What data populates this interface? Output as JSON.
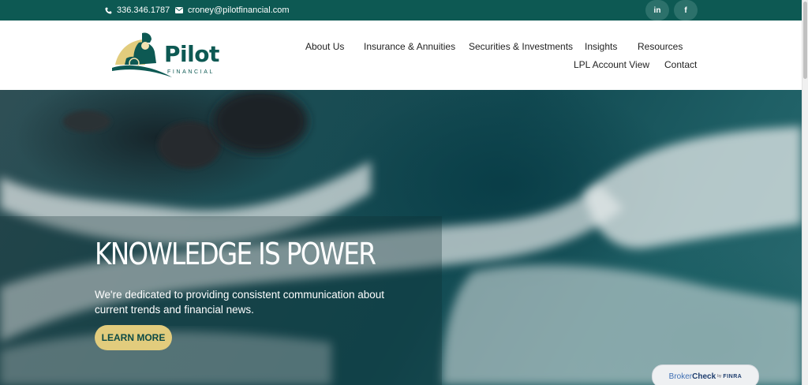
{
  "topbar": {
    "phone": "336.346.1787",
    "email": "croney@pilotfinancial.com",
    "social": [
      {
        "label": "in",
        "icon": "linkedin-icon"
      },
      {
        "label": "f",
        "icon": "facebook-icon"
      }
    ]
  },
  "brand": {
    "name": "Pilot",
    "sub": "FINANCIAL",
    "colors": {
      "primary": "#0d5953",
      "accent": "#e2cc7d"
    }
  },
  "nav": {
    "items": [
      "About Us",
      "Insurance & Annuities",
      "Securities & Investments",
      "Insights",
      "Resources",
      "LPL Account View",
      "Contact"
    ]
  },
  "hero": {
    "title": "KNOWLEDGE IS POWER",
    "text": "We're dedicated to providing consistent communication about current trends and financial news.",
    "cta": "LEARN MORE"
  },
  "brokercheck": {
    "part1": "Broker",
    "part2": "Check",
    "part3": "by",
    "part4": "FINRA"
  }
}
